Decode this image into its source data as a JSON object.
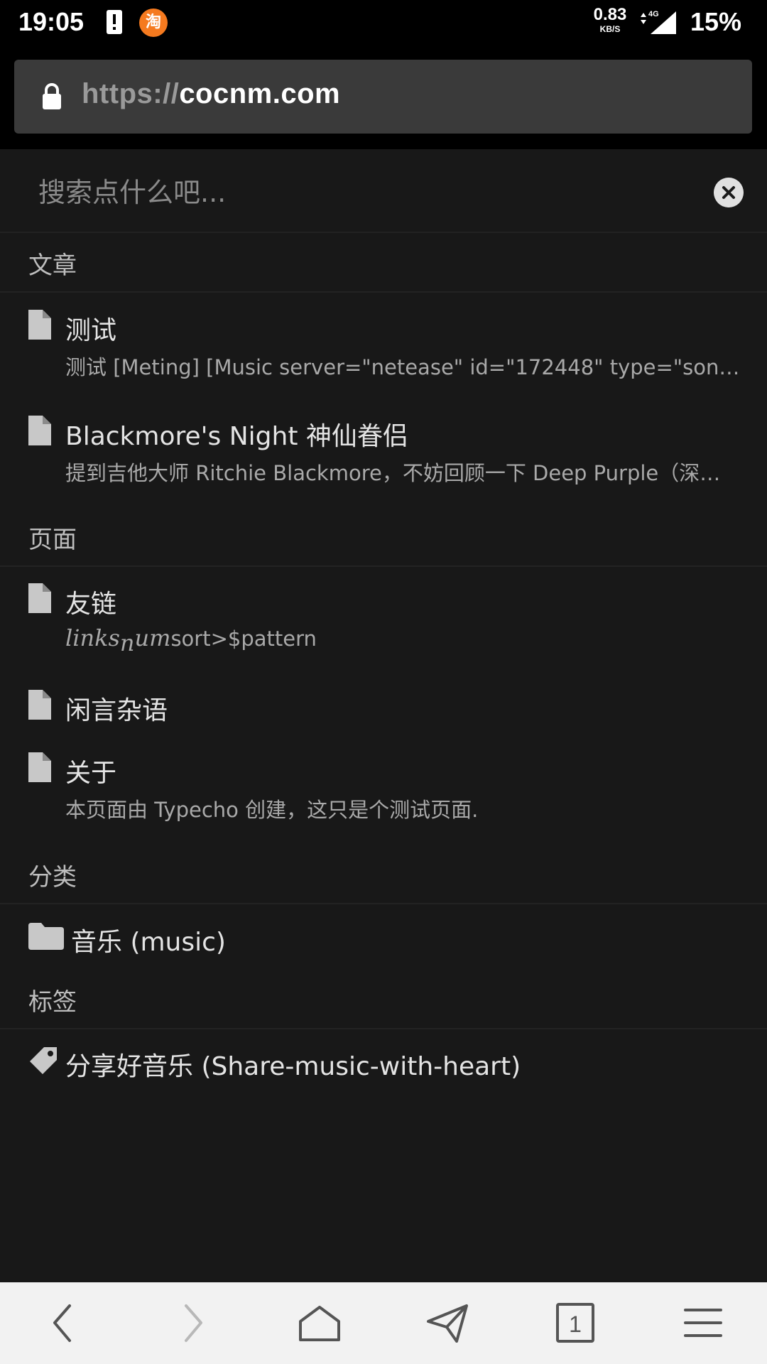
{
  "status_bar": {
    "time": "19:05",
    "taobao_label": "淘",
    "net_speed_value": "0.83",
    "net_speed_unit": "KB/S",
    "network_type": "4G",
    "battery": "15%"
  },
  "browser": {
    "url_scheme": "https://",
    "url_host": "cocnm.com"
  },
  "search": {
    "placeholder": "搜索点什么吧..."
  },
  "sections": {
    "articles": {
      "header": "文章",
      "items": [
        {
          "title": "测试",
          "excerpt": "测试 [Meting] [Music server=\"netease\" id=\"172448\" type=\"song\"]"
        },
        {
          "title": "Blackmore's Night 神仙眷侣",
          "excerpt": "提到吉他大师 Ritchie Blackmore，不妨回顾一下 Deep Purple（深紫乐队）"
        }
      ]
    },
    "pages": {
      "header": "页面",
      "items": [
        {
          "title": "友链",
          "excerpt_math_a": "links",
          "excerpt_math_sub": "n",
          "excerpt_math_b": "um",
          "excerpt_rest": "sort>$pattern"
        },
        {
          "title": "闲言杂语"
        },
        {
          "title": "关于",
          "excerpt": "本页面由 Typecho 创建，这只是个测试页面."
        }
      ]
    },
    "categories": {
      "header": "分类",
      "items": [
        {
          "title": "音乐 (music)"
        }
      ]
    },
    "tags": {
      "header": "标签",
      "items": [
        {
          "title": "分享好音乐 (Share-music-with-heart)"
        }
      ]
    }
  },
  "bottom_nav": {
    "tab_count": "1"
  },
  "colors": {
    "background": "#181818",
    "url_bar": "#3a3a3a",
    "bottom_nav": "#f2f2f2",
    "icon_gray": "#c8c8c8"
  }
}
